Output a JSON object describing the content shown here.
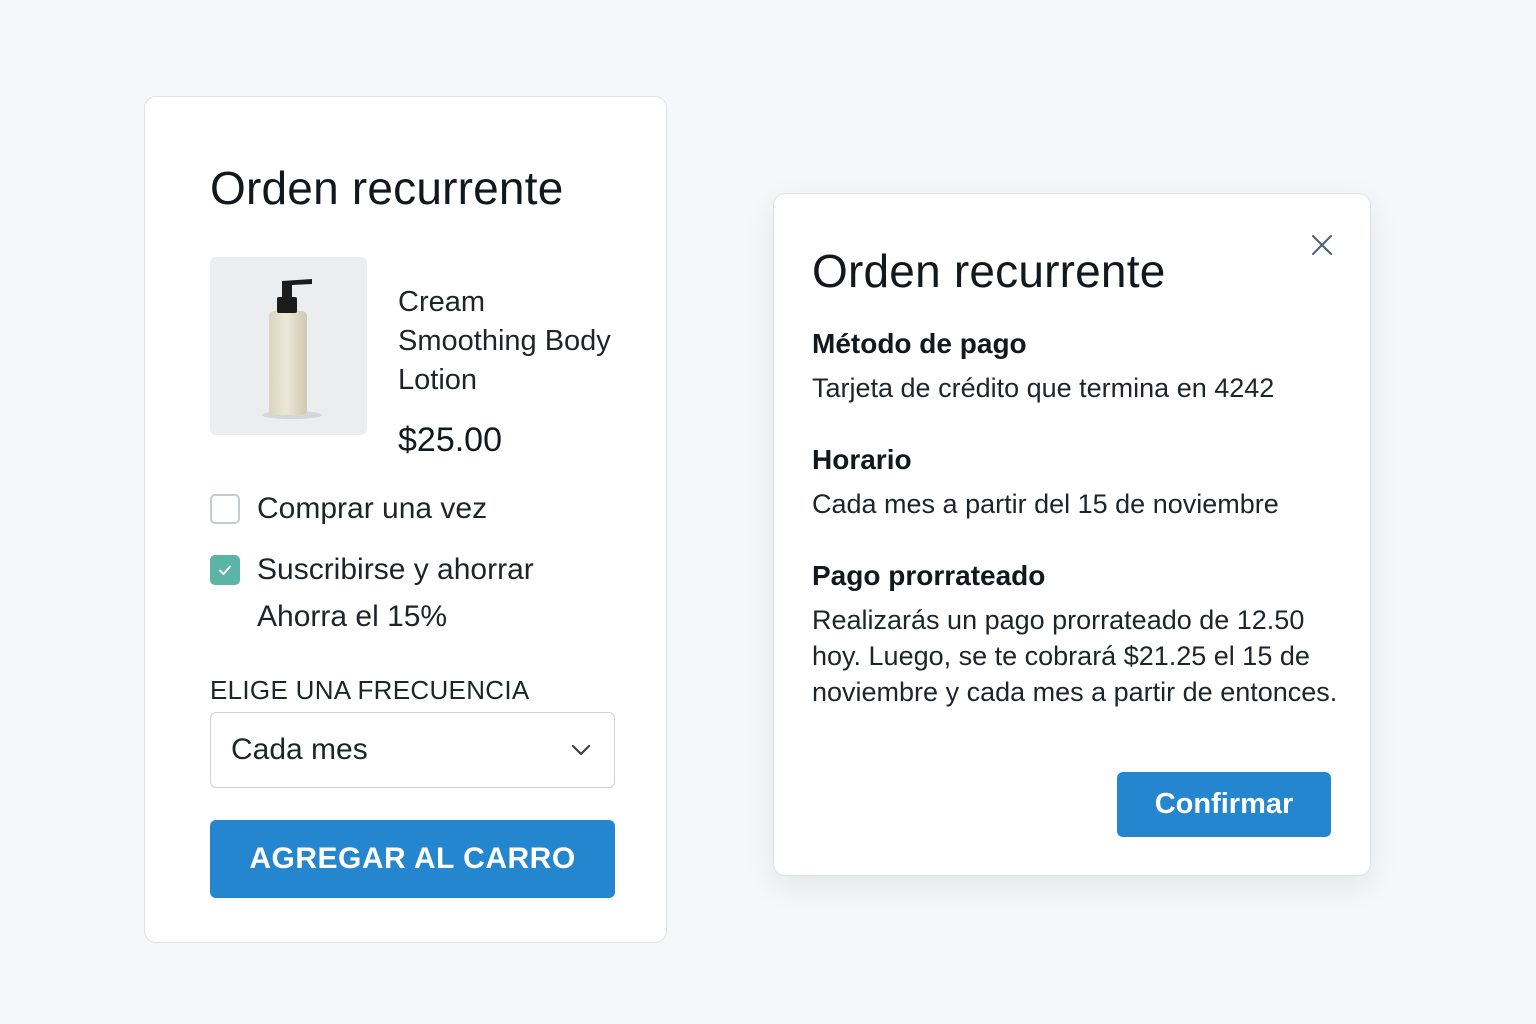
{
  "product_card": {
    "title": "Orden recurrente",
    "product": {
      "name": "Cream Smoothing Body Lotion",
      "price": "$25.00",
      "image": "lotion-bottle-icon"
    },
    "options": [
      {
        "label": "Comprar una vez",
        "checked": false
      },
      {
        "label": "Suscribirse y ahorrar",
        "checked": true
      }
    ],
    "savings_note": "Ahorra el 15%",
    "frequency": {
      "label": "ELIGE UNA FRECUENCIA",
      "selected": "Cada mes"
    },
    "add_to_cart_label": "AGREGAR AL CARRO"
  },
  "confirm_dialog": {
    "title": "Orden recurrente",
    "sections": [
      {
        "heading": "Método de pago",
        "body": "Tarjeta de crédito que termina en 4242"
      },
      {
        "heading": "Horario",
        "body": "Cada mes a partir del 15 de noviembre"
      },
      {
        "heading": "Pago prorrateado",
        "body": "Realizarás un pago prorrateado de 12.50 hoy. Luego, se te cobrará $21.25 el 15 de noviembre y cada mes a partir de entonces."
      }
    ],
    "confirm_label": "Confirmar",
    "close_icon": "close-icon"
  },
  "colors": {
    "accent": "#2386cf",
    "checkbox_checked": "#5bb5a6",
    "background": "#f6f7f9"
  }
}
